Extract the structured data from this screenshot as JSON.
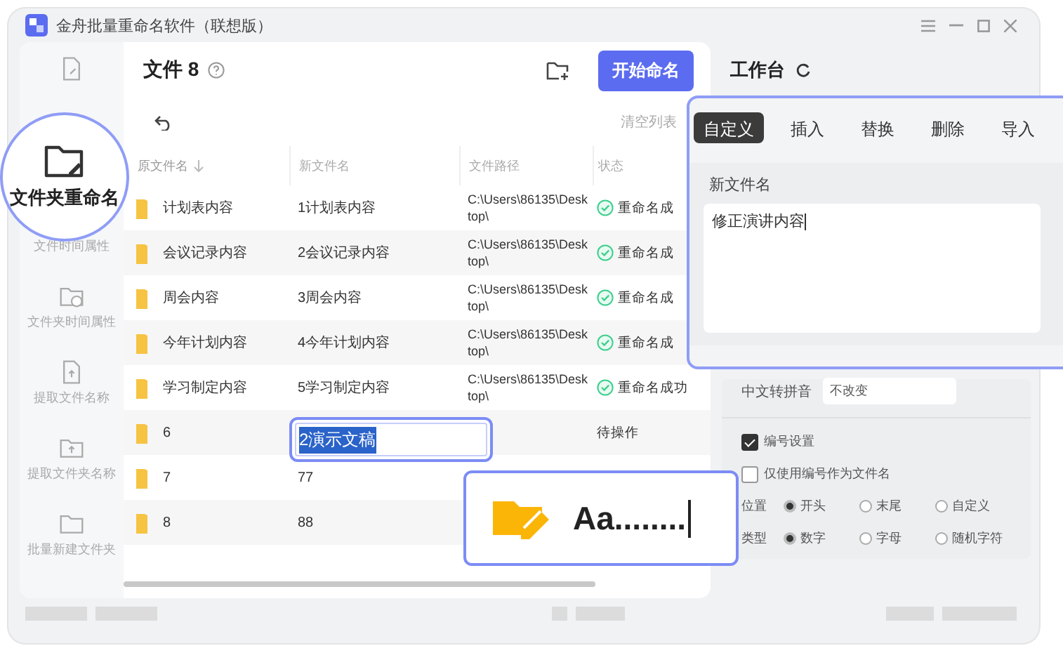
{
  "window": {
    "title": "金舟批量重命名软件（联想版）"
  },
  "sidebar": {
    "items": [
      {
        "selected": false
      },
      {
        "label": "文件夹重命名",
        "selected": true
      },
      {
        "label": "文件时间属性",
        "selected": false
      },
      {
        "label": "文件夹时间属性",
        "selected": false
      },
      {
        "label": "提取文件名称",
        "selected": false
      },
      {
        "label": "提取文件夹名称",
        "selected": false
      },
      {
        "label": "批量新建文件夹",
        "selected": false
      }
    ]
  },
  "toolbar": {
    "title": "文件 8",
    "start_button": "开始命名",
    "clear_link": "清空列表"
  },
  "table": {
    "columns": [
      {
        "label": "原文件名",
        "sorted": true
      },
      {
        "label": "新文件名",
        "sorted": false
      },
      {
        "label": "文件路径",
        "sorted": false
      },
      {
        "label": "状态",
        "sorted": false
      }
    ],
    "rows": [
      {
        "name": "计划表内容",
        "new_name": "1计划表内容",
        "path": "C:\\Users\\86135\\Desktop\\",
        "status": "重命名成",
        "done": true
      },
      {
        "name": "会议记录内容",
        "new_name": "2会议记录内容",
        "path": "C:\\Users\\86135\\Desktop\\",
        "status": "重命名成",
        "done": true
      },
      {
        "name": "周会内容",
        "new_name": "3周会内容",
        "path": "C:\\Users\\86135\\Desktop\\",
        "status": "重命名成",
        "done": true
      },
      {
        "name": "今年计划内容",
        "new_name": "4今年计划内容",
        "path": "C:\\Users\\86135\\Desktop\\",
        "status": "重命名成",
        "done": true
      },
      {
        "name": "学习制定内容",
        "new_name": "5学习制定内容",
        "path": "C:\\Users\\86135\\Desktop\\",
        "status": "重命名成功",
        "done": true
      },
      {
        "name": "6",
        "status": "待操作",
        "done": false
      },
      {
        "name": "7",
        "new_name": "77",
        "done": false
      },
      {
        "name": "8",
        "new_name": "88",
        "done": false
      }
    ]
  },
  "edit_box": {
    "value": "2演示文稿"
  },
  "preview_badge": {
    "text": "Aa........"
  },
  "workbench": {
    "title": "工作台",
    "pinyin": {
      "label": "中文转拼音",
      "value": "不改变"
    },
    "checkboxes": [
      {
        "label": "编号设置",
        "checked": true
      },
      {
        "label": "仅使用编号作为文件名",
        "checked": false
      }
    ],
    "radio_groups": [
      {
        "label": "位置",
        "options": [
          {
            "label": "开头",
            "selected": true
          },
          {
            "label": "末尾",
            "selected": false
          },
          {
            "label": "自定义",
            "selected": false
          }
        ]
      },
      {
        "label": "类型",
        "options": [
          {
            "label": "数字",
            "selected": true
          },
          {
            "label": "字母",
            "selected": false
          },
          {
            "label": "随机字符",
            "selected": false
          }
        ]
      }
    ]
  },
  "popup": {
    "tabs": [
      {
        "label": "自定义",
        "selected": true
      },
      {
        "label": "插入",
        "selected": false
      },
      {
        "label": "替换",
        "selected": false
      },
      {
        "label": "删除",
        "selected": false
      },
      {
        "label": "导入",
        "selected": false
      }
    ],
    "field_label": "新文件名",
    "value": "修正演讲内容"
  }
}
